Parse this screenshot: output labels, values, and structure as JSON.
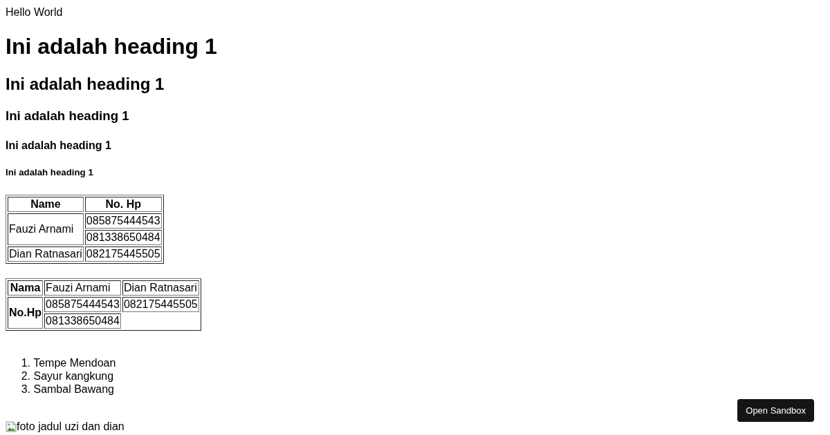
{
  "text": "Hello World",
  "headings": [
    {
      "kind": "h1",
      "text": "Ini adalah heading 1"
    },
    {
      "kind": "h2",
      "text": "Ini adalah heading 1"
    },
    {
      "kind": "h3",
      "text": "Ini adalah heading 1"
    },
    {
      "kind": "h4",
      "text": "Ini adalah heading 1"
    },
    {
      "kind": "h5",
      "text": "Ini adalah heading 1"
    }
  ],
  "table_1": {
    "columns": [
      "Name",
      "No. Hp"
    ],
    "rows": [
      {
        "name": "Fauzi Arnami",
        "phones": [
          "085875444543",
          "081338650484"
        ]
      },
      {
        "name": "Dian Ratnasari",
        "phones": [
          "082175445505"
        ]
      }
    ]
  },
  "table_2": {
    "name_label": "Nama",
    "names": [
      "Fauzi Arnami",
      "Dian Ratnasari"
    ],
    "phone_label": "No.Hp",
    "phone_rows": [
      [
        "085875444543",
        "082175445505"
      ],
      [
        "081338650484"
      ]
    ]
  },
  "list": [
    {
      "number": "1.",
      "text": "Tempe Mendoan"
    },
    {
      "number": "2.",
      "text": "Sayur kangkung"
    },
    {
      "number": "3.",
      "text": "Sambal Bawang"
    }
  ],
  "image": {
    "alt": "foto jadul uzi dan dian"
  },
  "button": {
    "label": "Open Sandbox"
  }
}
